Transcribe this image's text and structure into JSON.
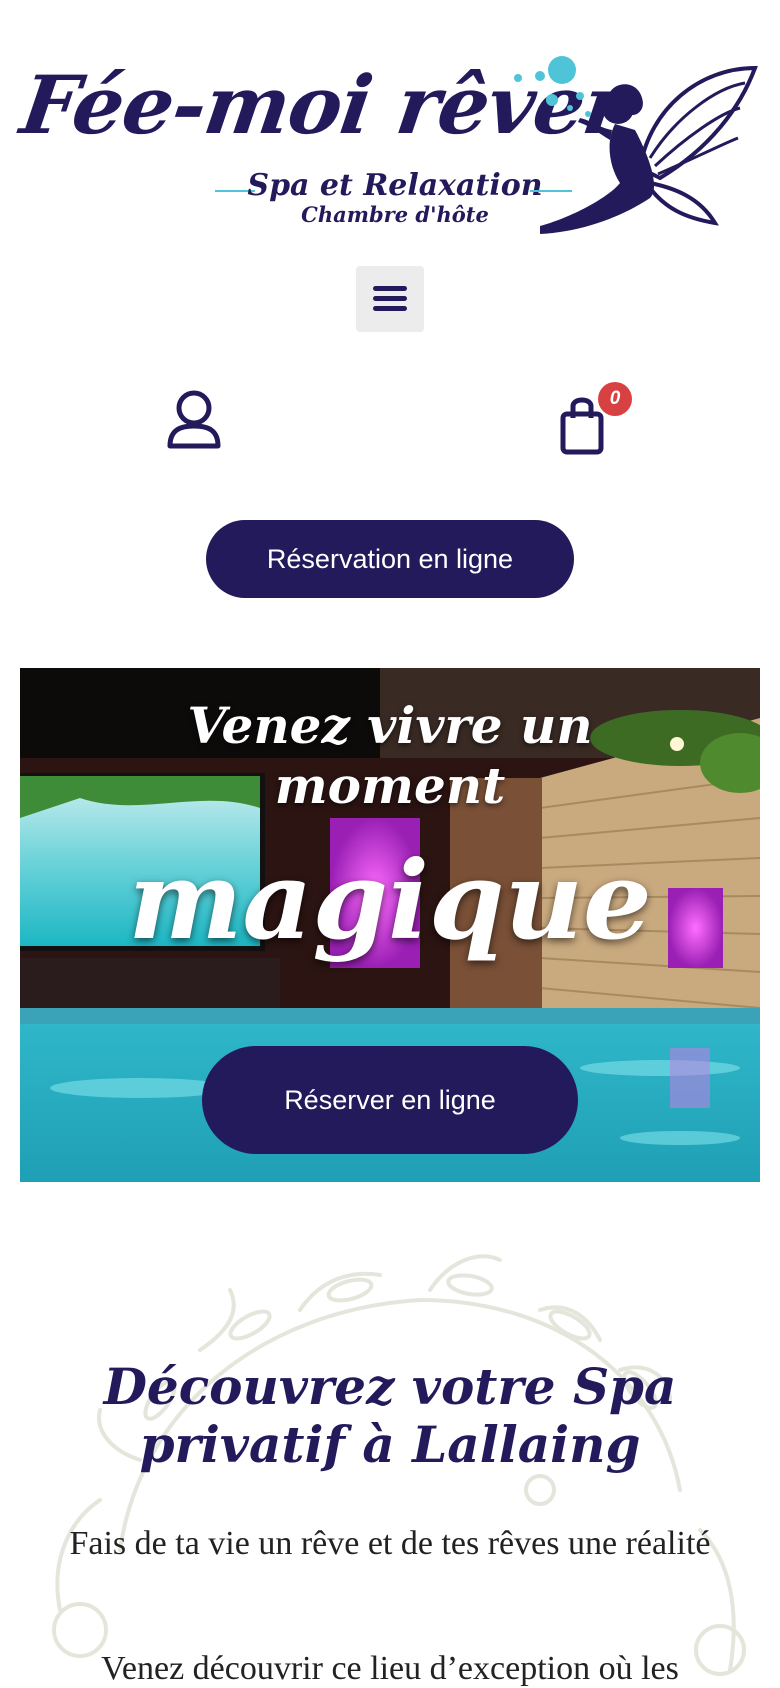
{
  "logo": {
    "title": "Fée-moi rêver",
    "subtitle": "Spa et Relaxation",
    "subtitle2": "Chambre d'hôte",
    "icon": "fairy-icon"
  },
  "header": {
    "menu_icon": "hamburger-menu-icon",
    "account_icon": "user-icon",
    "cart_icon": "shopping-bag-icon",
    "cart_count": "0"
  },
  "booking": {
    "label": "Réservation en ligne"
  },
  "hero": {
    "line1": "Venez vivre un",
    "line2": "moment",
    "big": "magique",
    "button_label": "Réserver en ligne"
  },
  "intro": {
    "title": "Découvrez votre Spa privatif à Lallaing",
    "paragraph1": "Fais de ta vie un rêve et de tes rêves une réalité",
    "paragraph2": "Venez découvrir ce lieu d’exception où les"
  },
  "colors": {
    "brand": "#231a5c",
    "accent": "#4fc4d8",
    "badge": "#d84141"
  }
}
